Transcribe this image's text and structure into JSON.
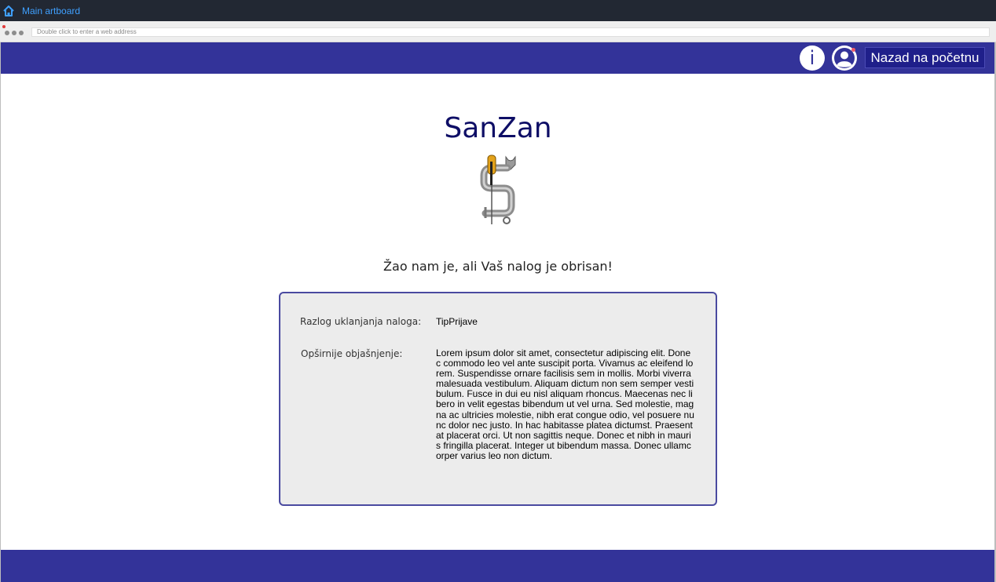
{
  "app_bar": {
    "title": "Main artboard",
    "icon": "home-icon",
    "accent": "#3fa0ff"
  },
  "browser": {
    "address_placeholder": "Double click to enter a web address"
  },
  "header": {
    "background": "#333399",
    "info_label": "i",
    "profile_icon": "user-icon",
    "back_label": "Nazad na početnu"
  },
  "main": {
    "brand": "SanZan",
    "logo_icon": "sanzan-logo",
    "message": "Žao nam je, ali Vaš nalog je obrisan!",
    "card": {
      "reason_label": "Razlog uklanjanja naloga:",
      "reason_value": "TipPrijave",
      "detail_label": "Opširnije objašnjenje:",
      "detail_value": "Lorem ipsum dolor sit amet, consectetur adipiscing elit. Donec commodo leo vel ante suscipit porta. Vivamus ac eleifend lorem. Suspendisse ornare facilisis sem in mollis. Morbi viverra malesuada vestibulum. Aliquam dictum non sem semper vestibulum. Fusce in dui eu nisl aliquam rhoncus. Maecenas nec libero in velit egestas bibendum ut vel urna. Sed molestie, magna ac ultricies molestie, nibh erat congue odio, vel posuere nunc dolor nec justo. In hac habitasse platea dictumst. Praesent at placerat orci. Ut non sagittis neque. Donec et nibh in mauris fringilla placerat. Integer ut bibendum massa. Donec ullamcorper varius leo non dictum."
    }
  }
}
